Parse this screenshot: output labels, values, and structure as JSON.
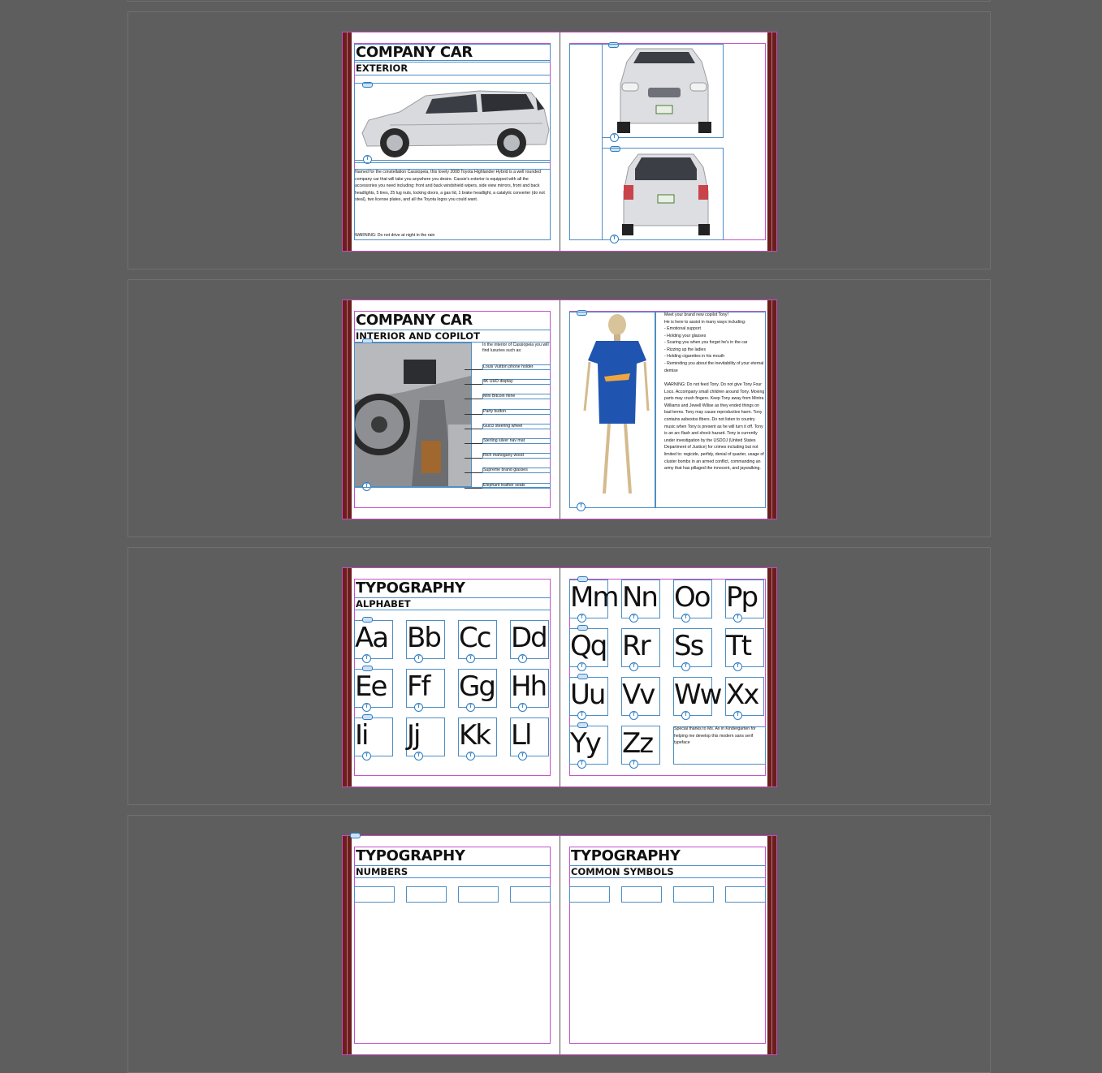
{
  "spreads": [
    {
      "left": {
        "title": "COMPANY CAR",
        "subtitle": "EXTERIOR",
        "body": "Named for the constellation Cassiopeia, this lovely 2008 Toyota Highlander Hybrid is a well rounded company car that will take you anywhere you desire. Cassie's exterior is equipped with all the accessories you need including: front and back windshield wipers, side view mirrors, front and back headlights, 5 tires, 25 lug nuts, locking doors, a gas lid, 1 brake headlight, a catalytic converter (do not steal), two license plates, and all the Toyota logos you could want.",
        "warning": "WARNING: Do not drive at night in the rain"
      }
    },
    {
      "left": {
        "title": "COMPANY CAR",
        "subtitle": "INTERIOR AND COPILOT",
        "intro": "In the interior of Cassiopeia you will find luxuries such as:",
        "callouts": [
          "Louis Vuitton phone holder",
          "4K UHD display",
          "Mini Bitcoin mine",
          "Party button",
          "Gucci steering wheel",
          "Sterling silver nav mat",
          "Rich mahogany wood",
          "Supreme brand glasses",
          "Elephant leather seats"
        ]
      },
      "right": {
        "intro": "Meet your brand new copilot Tony!\nHe is here to assist in many ways including:",
        "list": [
          "- Emotional support",
          "- Holding your glasses",
          "- Scaring you when you forget he's in the car",
          "- Rizzing up the ladies",
          "- Holding cigarettes in his mouth",
          "- Reminding you about the inevitability of your eternal demise"
        ],
        "warning": "WARNING: Do not feed Tony. Do not give Tony Four Loco. Accompany small children around Tony. Moving parts may crush fingers. Keep Tony away from Mintra Williams and Jewell Wilise as they ended things on bad terms. Tony may cause reproductive harm. Tony contains asbestos fibers. Do not listen to country music when Tony is present as he will turn it off. Tony is an arc flash and shock hazard. Tony is currently under investigation by the USDOJ (United States Department of Justice) for crimes including but not limited to: regicide, perfidy, denial of quarter, usage of cluster bombs in an armed conflict, commanding an army that has pillaged the innocent, and jaywalking."
      }
    },
    {
      "left": {
        "title": "TYPOGRAPHY",
        "subtitle": "ALPHABET",
        "letters": [
          "Aa",
          "Bb",
          "Cc",
          "Dd",
          "Ee",
          "Ff",
          "Gg",
          "Hh",
          "Ii",
          "Jj",
          "Kk",
          "Ll"
        ]
      },
      "right": {
        "letters": [
          "Mm",
          "Nn",
          "Oo",
          "Pp",
          "Qq",
          "Rr",
          "Ss",
          "Tt",
          "Uu",
          "Vv",
          "Ww",
          "Xx",
          "Yy",
          "Zz"
        ],
        "thanks": "Special thanks to Ms. Ax in Kindergarten for helping me develop this modern sans serif typeface"
      }
    },
    {
      "left": {
        "title": "TYPOGRAPHY",
        "subtitle": "NUMBERS"
      },
      "right": {
        "title": "TYPOGRAPHY",
        "subtitle": "COMMON SYMBOLS"
      }
    }
  ],
  "icons": {
    "text_frame": "T",
    "link": "link-icon"
  },
  "colors": {
    "pasteboard": "#5e5e5e",
    "margin_guide": "#c455c8",
    "frame_edge": "#4e8fc4",
    "bleed": "#6a1e1e"
  }
}
